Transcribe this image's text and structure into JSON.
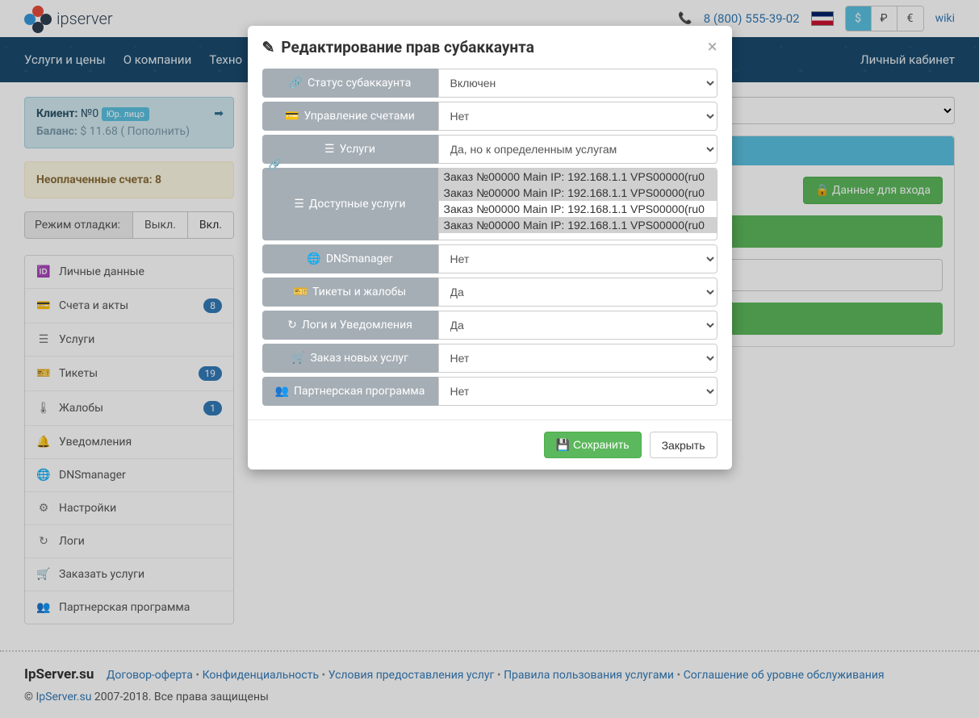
{
  "top": {
    "phone": "8 (800) 555-39-02",
    "wiki": "wiki",
    "logo_text": "ipserver",
    "currencies": [
      "$",
      "₽",
      "€"
    ]
  },
  "nav": {
    "items": [
      "Услуги и цены",
      "О компании",
      "Техно"
    ],
    "cabinet": "Личный кабинет"
  },
  "client": {
    "label": "Клиент:",
    "num": "№0",
    "legal": "Юр. лицо",
    "balance_label": "Баланс:",
    "balance_cur": "$",
    "balance_val": "11.68",
    "topup": "( Пополнить)"
  },
  "unpaid": {
    "label": "Неоплаченные счета:",
    "count": "8"
  },
  "debug": {
    "label": "Режим отладки:",
    "off": "Выкл.",
    "on": "Вкл."
  },
  "sidebar": {
    "items": [
      {
        "icon": "🆔",
        "label": "Личные данные",
        "badge": ""
      },
      {
        "icon": "💳",
        "label": "Счета и акты",
        "badge": "8"
      },
      {
        "icon": "☰",
        "label": "Услуги",
        "badge": ""
      },
      {
        "icon": "🎫",
        "label": "Тикеты",
        "badge": "19"
      },
      {
        "icon": "🌡",
        "label": "Жалобы",
        "badge": "1"
      },
      {
        "icon": "🔔",
        "label": "Уведомления",
        "badge": ""
      },
      {
        "icon": "🌐",
        "label": "DNSmanager",
        "badge": ""
      },
      {
        "icon": "⚙",
        "label": "Настройки",
        "badge": ""
      },
      {
        "icon": "↻",
        "label": "Логи",
        "badge": ""
      },
      {
        "icon": "🛒",
        "label": "Заказать услуги",
        "badge": ""
      },
      {
        "icon": "👥",
        "label": "Партнерская программа",
        "badge": ""
      }
    ]
  },
  "right_btn": "Данные для входа",
  "footer": {
    "brand": "IpServer.su",
    "links": [
      "Договор-оферта",
      "Конфиденциальность",
      "Условия предоставления услуг",
      "Правила пользования услугами",
      "Соглашение об уровне обслуживания"
    ],
    "copy_link": "IpServer.su",
    "copy_rest": " 2007-2018. Все права защищены"
  },
  "modal": {
    "title": "Редактирование прав субаккаунта",
    "rows": [
      {
        "icon": "🔗",
        "label": "Статус субаккаунта",
        "value": "Включен"
      },
      {
        "icon": "💳",
        "label": "Управление счетами",
        "value": "Нет"
      },
      {
        "icon": "☰",
        "label": "Услуги",
        "value": "Да, но к определенным услугам"
      }
    ],
    "available": {
      "icon": "☰",
      "label": "Доступные услуги",
      "options": [
        "Заказ №00000 Main IP: 192.168.1.1 VPS00000(ru0",
        "Заказ №00000 Main IP: 192.168.1.1 VPS00000(ru0",
        "Заказ №00000 Main IP: 192.168.1.1 VPS00000(ru0",
        "Заказ №00000 Main IP: 192.168.1.1 VPS00000(ru0"
      ]
    },
    "rows2": [
      {
        "icon": "🌐",
        "label": "DNSmanager",
        "value": "Нет"
      },
      {
        "icon": "🎫",
        "label": "Тикеты и жалобы",
        "value": "Да"
      },
      {
        "icon": "↻",
        "label": "Логи и Уведомления",
        "value": "Да"
      },
      {
        "icon": "🛒",
        "label": "Заказ новых услуг",
        "value": "Нет"
      },
      {
        "icon": "👥",
        "label": "Партнерская программа",
        "value": "Нет"
      }
    ],
    "save": "Сохранить",
    "close": "Закрыть"
  }
}
